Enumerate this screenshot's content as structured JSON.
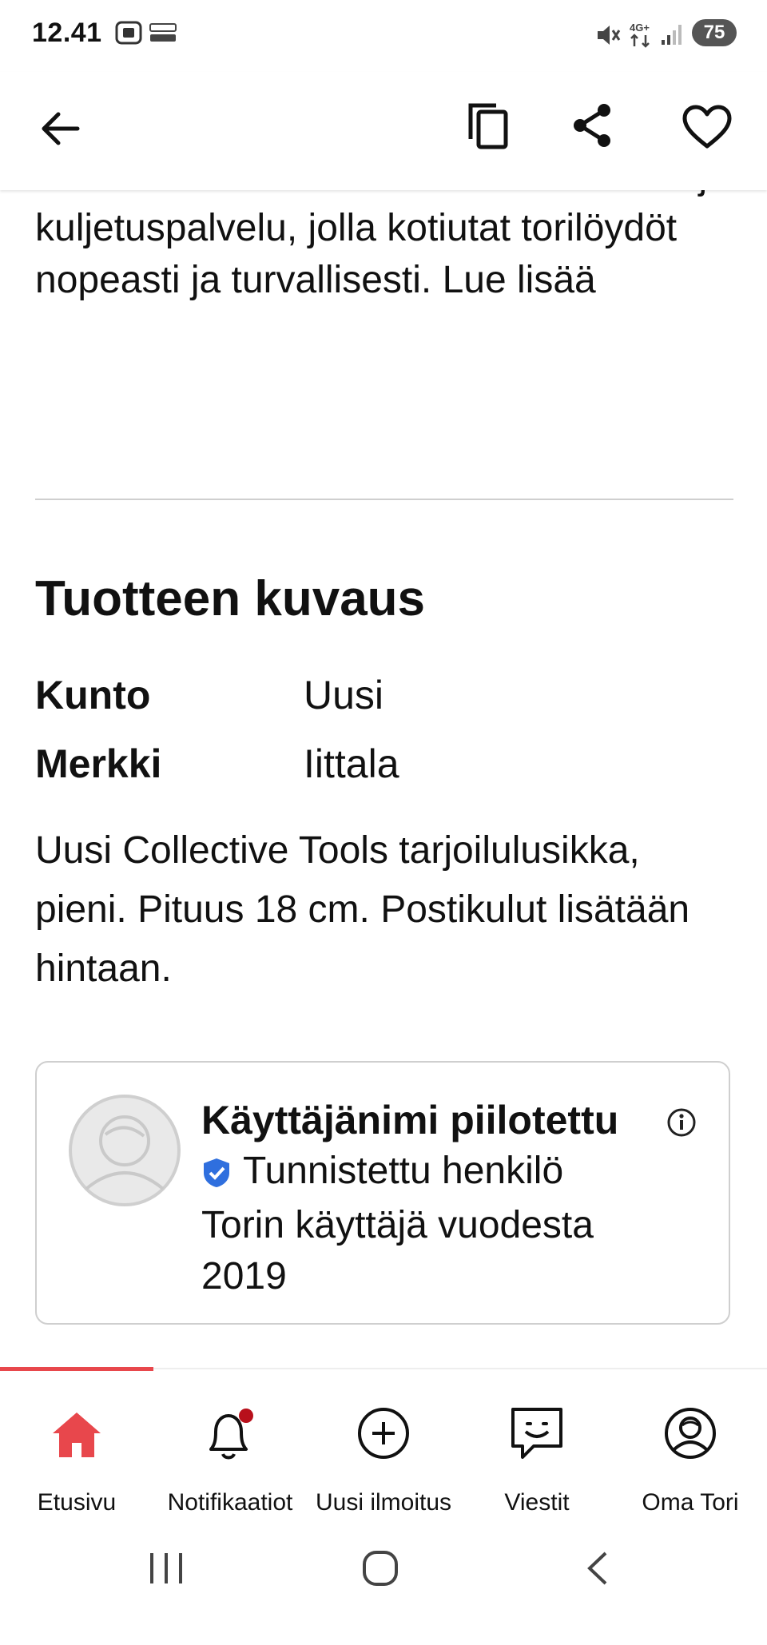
{
  "status_bar": {
    "time": "12.41",
    "network": "4G+",
    "battery": "75",
    "icons": [
      "screenshot-icon",
      "temu-notification-icon",
      "mute-icon",
      "network-4g-icon",
      "signal-icon",
      "battery-icon"
    ]
  },
  "app_bar": {
    "icons": [
      "back-arrow-icon",
      "copy-icon",
      "share-icon",
      "heart-icon"
    ]
  },
  "intro": {
    "text": "ToriDiilia. ToriDiili on Torin uusi maksu- ja kuljetuspalvelu, jolla kotiutat torilöydöt nopeasti ja turvallisesti. Lue lisää"
  },
  "product": {
    "section_title": "Tuotteen kuvaus",
    "attributes": [
      {
        "key": "Kunto",
        "value": "Uusi"
      },
      {
        "key": "Merkki",
        "value": "Iittala"
      }
    ],
    "description": "Uusi Collective Tools tarjoilulusikka, pieni. Pituus 18 cm. Postikulut lisätään hintaan."
  },
  "seller": {
    "name": "Käyttäjänimi piilotettu",
    "verified_label": "Tunnistettu henkilö",
    "member_since": "Torin käyttäjä vuodesta 2019",
    "verified_color": "#2f6fde"
  },
  "bottom_nav": {
    "active_color": "#e8474c",
    "notification_dot_color": "#b8101b",
    "items": [
      {
        "label": "Etusivu",
        "icon": "home-icon",
        "active": true
      },
      {
        "label": "Notifikaatiot",
        "icon": "bell-icon",
        "active": false
      },
      {
        "label": "Uusi ilmoitus",
        "icon": "plus-circle-icon",
        "active": false
      },
      {
        "label": "Viestit",
        "icon": "chat-icon",
        "active": false
      },
      {
        "label": "Oma Tori",
        "icon": "profile-icon",
        "active": false
      }
    ]
  },
  "system_nav": {
    "icons": [
      "recents-icon",
      "home-circle-icon",
      "system-back-icon"
    ]
  }
}
